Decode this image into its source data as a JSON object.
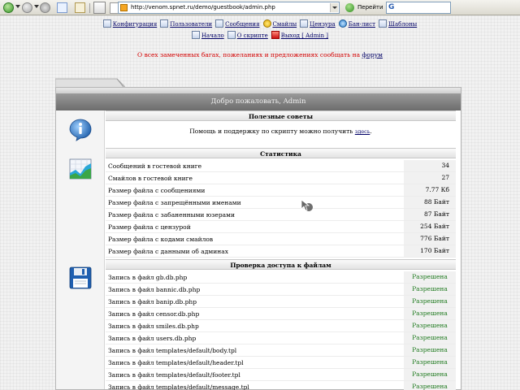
{
  "browser": {
    "url": "http://venom.spnet.ru/demo/guestbook/admin.php",
    "go_label": "Перейти",
    "search_value": ""
  },
  "nav": {
    "row1": [
      {
        "label": "Конфигурация",
        "icon": "config-icon"
      },
      {
        "label": "Пользователи",
        "icon": "users-icon"
      },
      {
        "label": "Сообщения",
        "icon": "messages-icon"
      },
      {
        "label": "Смайлы",
        "icon": "smiles-icon"
      },
      {
        "label": "Цензура",
        "icon": "censor-icon"
      },
      {
        "label": "Бан-лист",
        "icon": "banlist-icon"
      },
      {
        "label": "Шаблоны",
        "icon": "templates-icon"
      }
    ],
    "row2": [
      {
        "label": "Начало",
        "icon": "home-icon"
      },
      {
        "label": "О скрипте",
        "icon": "about-icon"
      },
      {
        "label": "Выход [ Admin ]",
        "icon": "logout-icon"
      }
    ]
  },
  "notice": {
    "text": "О всех замеченных багах, пожеланиях и предложениях сообщать на ",
    "link": "форум"
  },
  "panel": {
    "welcome": "Добро пожаловать, Admin",
    "tips": {
      "title": "Полезные советы",
      "text": "Помощь и поддержку по скрипту можно получить ",
      "link": "здесь",
      "end": "."
    },
    "stats": {
      "title": "Статистика",
      "rows": [
        {
          "label": "Сообщений в гостевой книге",
          "value": "34"
        },
        {
          "label": "Смайлов в гостевой книге",
          "value": "27"
        },
        {
          "label": "Размер файла с сообщениями",
          "value": "7.77 Кб"
        },
        {
          "label": "Размер файла с запрещёнными именами",
          "value": "88 Байт"
        },
        {
          "label": "Размер файла с забаненными юзерами",
          "value": "87 Байт"
        },
        {
          "label": "Размер файла с цензурой",
          "value": "254 Байт"
        },
        {
          "label": "Размер файла с кодами смайлов",
          "value": "776 Байт"
        },
        {
          "label": "Размер файла с данными об админах",
          "value": "170 Байт"
        }
      ]
    },
    "access": {
      "title": "Проверка доступа к файлам",
      "rows": [
        {
          "label": "Запись в файл gb.db.php",
          "value": "Разрешена"
        },
        {
          "label": "Запись в файл bannic.db.php",
          "value": "Разрешена"
        },
        {
          "label": "Запись в файл banip.db.php",
          "value": "Разрешена"
        },
        {
          "label": "Запись в файл censor.db.php",
          "value": "Разрешена"
        },
        {
          "label": "Запись в файл smiles.db.php",
          "value": "Разрешена"
        },
        {
          "label": "Запись в файл users.db.php",
          "value": "Разрешена"
        },
        {
          "label": "Запись в файл templates/default/body.tpl",
          "value": "Разрешена"
        },
        {
          "label": "Запись в файл templates/default/header.tpl",
          "value": "Разрешена"
        },
        {
          "label": "Запись в файл templates/default/footer.tpl",
          "value": "Разрешена"
        },
        {
          "label": "Запись в файл templates/default/message.tpl",
          "value": "Разрешена"
        }
      ]
    }
  },
  "colors": {
    "link": "#000066",
    "notice": "#d40000",
    "allowed": "#1f7a1f",
    "header_bg": "#7a7a7a"
  }
}
